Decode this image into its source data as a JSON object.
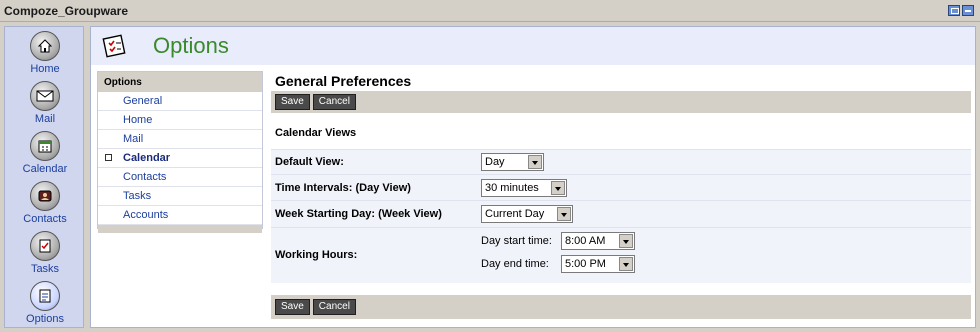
{
  "window": {
    "title": "Compoze_Groupware"
  },
  "app_nav": [
    {
      "label": "Home",
      "icon": "home-icon"
    },
    {
      "label": "Mail",
      "icon": "mail-icon"
    },
    {
      "label": "Calendar",
      "icon": "calendar-icon"
    },
    {
      "label": "Contacts",
      "icon": "contacts-icon"
    },
    {
      "label": "Tasks",
      "icon": "tasks-icon"
    },
    {
      "label": "Options",
      "icon": "options-icon"
    }
  ],
  "header": {
    "title": "Options",
    "icon": "options-checklist-icon"
  },
  "options_nav": {
    "heading": "Options",
    "items": [
      {
        "label": "General",
        "active": false
      },
      {
        "label": "Home",
        "active": false
      },
      {
        "label": "Mail",
        "active": false
      },
      {
        "label": "Calendar",
        "active": true
      },
      {
        "label": "Contacts",
        "active": false
      },
      {
        "label": "Tasks",
        "active": false
      },
      {
        "label": "Accounts",
        "active": false
      }
    ]
  },
  "prefs": {
    "title": "General Preferences",
    "save_label": "Save",
    "cancel_label": "Cancel",
    "section": "Calendar Views",
    "default_view": {
      "label": "Default View:",
      "value": "Day"
    },
    "time_intervals": {
      "label": "Time Intervals: (Day View)",
      "value": "30 minutes"
    },
    "week_start": {
      "label": "Week Starting Day: (Week View)",
      "value": "Current Day"
    },
    "working_hours": {
      "label": "Working Hours:",
      "start_label": "Day start time:",
      "start_value": "8:00 AM",
      "end_label": "Day end time:",
      "end_value": "5:00 PM"
    }
  },
  "colors": {
    "accent_green": "#3a8a2c",
    "link_blue": "#1c3f9c",
    "chrome": "#d4d0c8"
  }
}
